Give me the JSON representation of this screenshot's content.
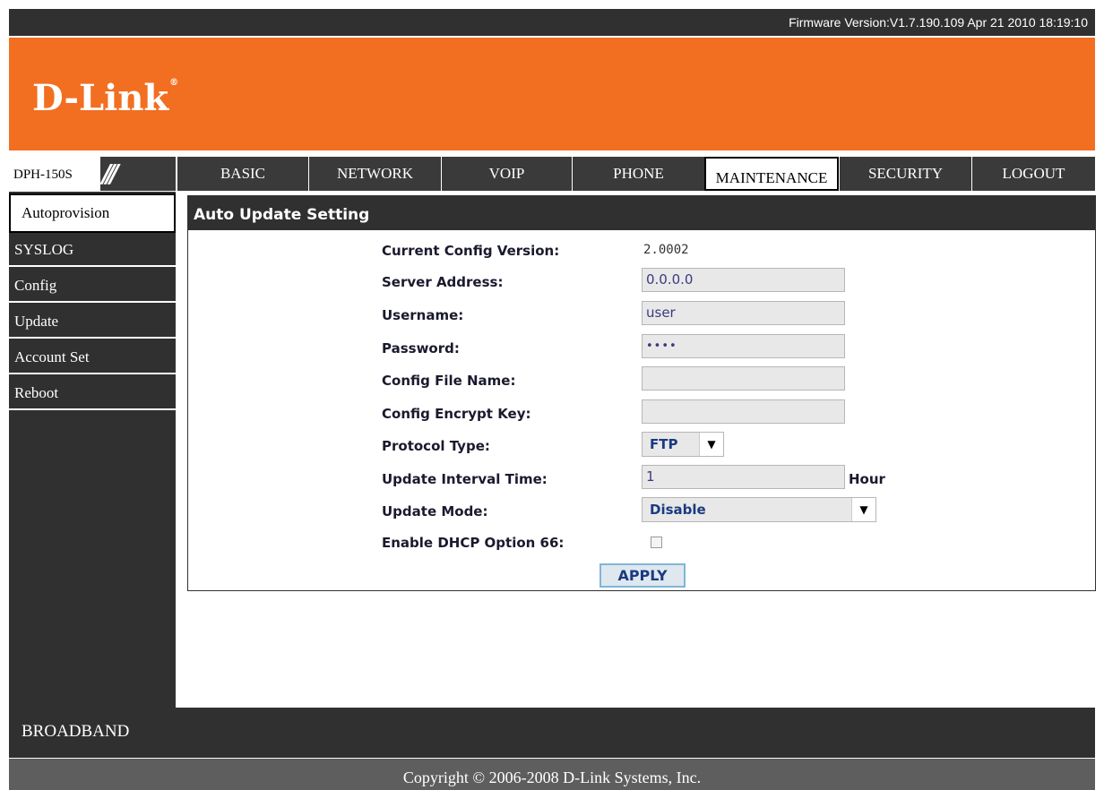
{
  "topbar": {
    "firmware": "Firmware Version:V1.7.190.109 Apr 21 2010 18:19:10"
  },
  "brand": {
    "logo_text": "D-Link",
    "logo_mark": "®"
  },
  "model": {
    "label": "DPH-150S",
    "decoration": "///"
  },
  "nav": {
    "tabs": [
      {
        "label": "BASIC"
      },
      {
        "label": "NETWORK"
      },
      {
        "label": "VOIP"
      },
      {
        "label": "PHONE"
      },
      {
        "label": "MAINTENANCE",
        "active": true
      },
      {
        "label": "SECURITY"
      },
      {
        "label": "LOGOUT"
      }
    ]
  },
  "sidebar": {
    "items": [
      {
        "label": "Autoprovision",
        "active": true
      },
      {
        "label": "SYSLOG"
      },
      {
        "label": "Config"
      },
      {
        "label": "Update"
      },
      {
        "label": "Account Set"
      },
      {
        "label": "Reboot"
      }
    ]
  },
  "panel": {
    "title": "Auto Update Setting",
    "current_config_version": {
      "label": "Current Config Version:",
      "value": "2.0002"
    },
    "server_address": {
      "label": "Server Address:",
      "value": "0.0.0.0"
    },
    "username": {
      "label": "Username:",
      "value": "user"
    },
    "password": {
      "label": "Password:",
      "value": "••••"
    },
    "config_file_name": {
      "label": "Config File Name:",
      "value": ""
    },
    "config_encrypt_key": {
      "label": "Config Encrypt Key:",
      "value": ""
    },
    "protocol_type": {
      "label": "Protocol Type:",
      "value": "FTP"
    },
    "update_interval": {
      "label": "Update Interval Time:",
      "value": "1",
      "unit": "Hour"
    },
    "update_mode": {
      "label": "Update Mode:",
      "value": "Disable"
    },
    "dhcp_option_66": {
      "label": "Enable DHCP Option 66:",
      "checked": false
    },
    "apply_label": "APPLY"
  },
  "footer": {
    "broadband": "BROADBAND",
    "copyright": "Copyright © 2006-2008 D-Link Systems, Inc."
  },
  "colors": {
    "brand_orange": "#f26e21",
    "dark_bar": "#303030",
    "footer_gray": "#5e5e5e"
  }
}
